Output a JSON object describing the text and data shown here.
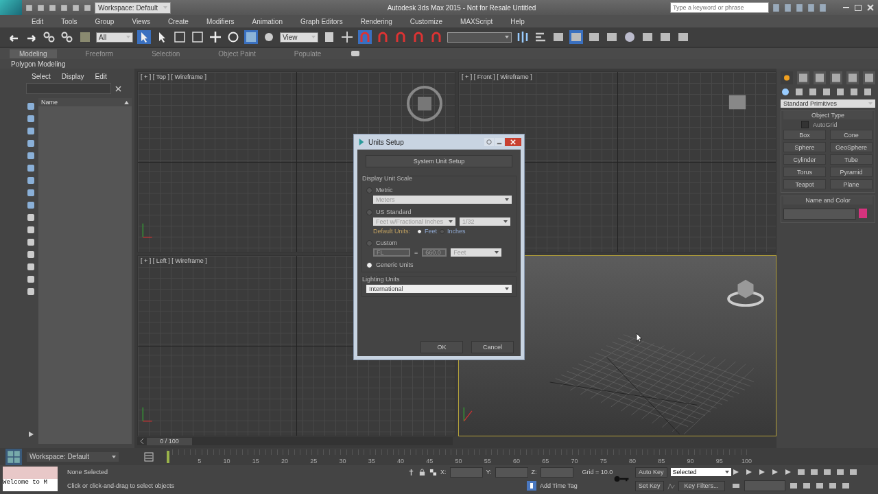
{
  "window": {
    "title": "Autodesk 3ds Max 2015 - Not for Resale   Untitled",
    "workspace": "Workspace: Default"
  },
  "search": {
    "placeholder": "Type a keyword or phrase"
  },
  "menu": [
    "Edit",
    "Tools",
    "Group",
    "Views",
    "Create",
    "Modifiers",
    "Animation",
    "Graph Editors",
    "Rendering",
    "Customize",
    "MAXScript",
    "Help"
  ],
  "toolbar": {
    "selection_filter": "All",
    "reference_coord": "View"
  },
  "ribbon": {
    "tabs": [
      {
        "label": "Modeling",
        "selected": true
      },
      {
        "label": "Freeform",
        "selected": false
      },
      {
        "label": "Selection",
        "selected": false
      },
      {
        "label": "Object Paint",
        "selected": false
      },
      {
        "label": "Populate",
        "selected": false
      }
    ],
    "panel": "Polygon Modeling"
  },
  "explorer": {
    "menu": [
      "Select",
      "Display",
      "Edit"
    ],
    "column": "Name"
  },
  "viewports": [
    {
      "label": "[ + ] [ Top ] [ Wireframe ]",
      "kind": "ortho",
      "selected": false
    },
    {
      "label": "[ + ] [ Front ] [ Wireframe ]",
      "kind": "ortho",
      "selected": false
    },
    {
      "label": "[ + ] [ Left ] [ Wireframe ]",
      "kind": "ortho",
      "selected": false
    },
    {
      "kind": "perspective",
      "selected": true
    }
  ],
  "dialog": {
    "title": "Units Setup",
    "system_button": "System Unit Setup",
    "group": "Display Unit Scale",
    "metric": {
      "label": "Metric",
      "selected": false,
      "unit": "Meters"
    },
    "us": {
      "label": "US Standard",
      "selected": false,
      "unit": "Feet w/Fractional Inches",
      "fraction": "1/32",
      "default_label": "Default Units:",
      "defaults": [
        {
          "label": "Feet",
          "selected": true
        },
        {
          "label": "Inches",
          "selected": false
        }
      ]
    },
    "custom": {
      "label": "Custom",
      "selected": false,
      "name": "FL",
      "equals": "=",
      "value": "660.0",
      "unit": "Feet"
    },
    "generic": {
      "label": "Generic Units",
      "selected": true
    },
    "lighting_group": "Lighting Units",
    "lighting": "International",
    "buttons": [
      "OK",
      "Cancel"
    ]
  },
  "command_panel": {
    "category": "Standard Primitives",
    "object_type": "Object Type",
    "autogrid": {
      "label": "AutoGrid",
      "checked": false
    },
    "buttons": [
      "Box",
      "Cone",
      "Sphere",
      "GeoSphere",
      "Cylinder",
      "Tube",
      "Torus",
      "Pyramid",
      "Teapot",
      "Plane"
    ],
    "name_and_color": "Name and Color",
    "color": "#d6337e"
  },
  "timeline": {
    "slider": "0 / 100",
    "level": 0,
    "ticks": [
      "5",
      "10",
      "15",
      "20",
      "25",
      "30",
      "35",
      "40",
      "45",
      "50",
      "55",
      "60",
      "65",
      "70",
      "75",
      "80",
      "85",
      "90",
      "95",
      "100"
    ]
  },
  "status": {
    "workspace": "Workspace: Default",
    "maxscript": "Welcome to M",
    "selection": "None Selected",
    "prompt": "Click or click-and-drag to select objects",
    "coords": [
      "X:",
      "Y:",
      "Z:"
    ],
    "grid": "Grid = 10.0",
    "auto_key": "Auto Key",
    "key_mode": "Selected",
    "set_key": "Set Key",
    "key_filters": "Key Filters...",
    "time_tag": "Add Time Tag"
  }
}
